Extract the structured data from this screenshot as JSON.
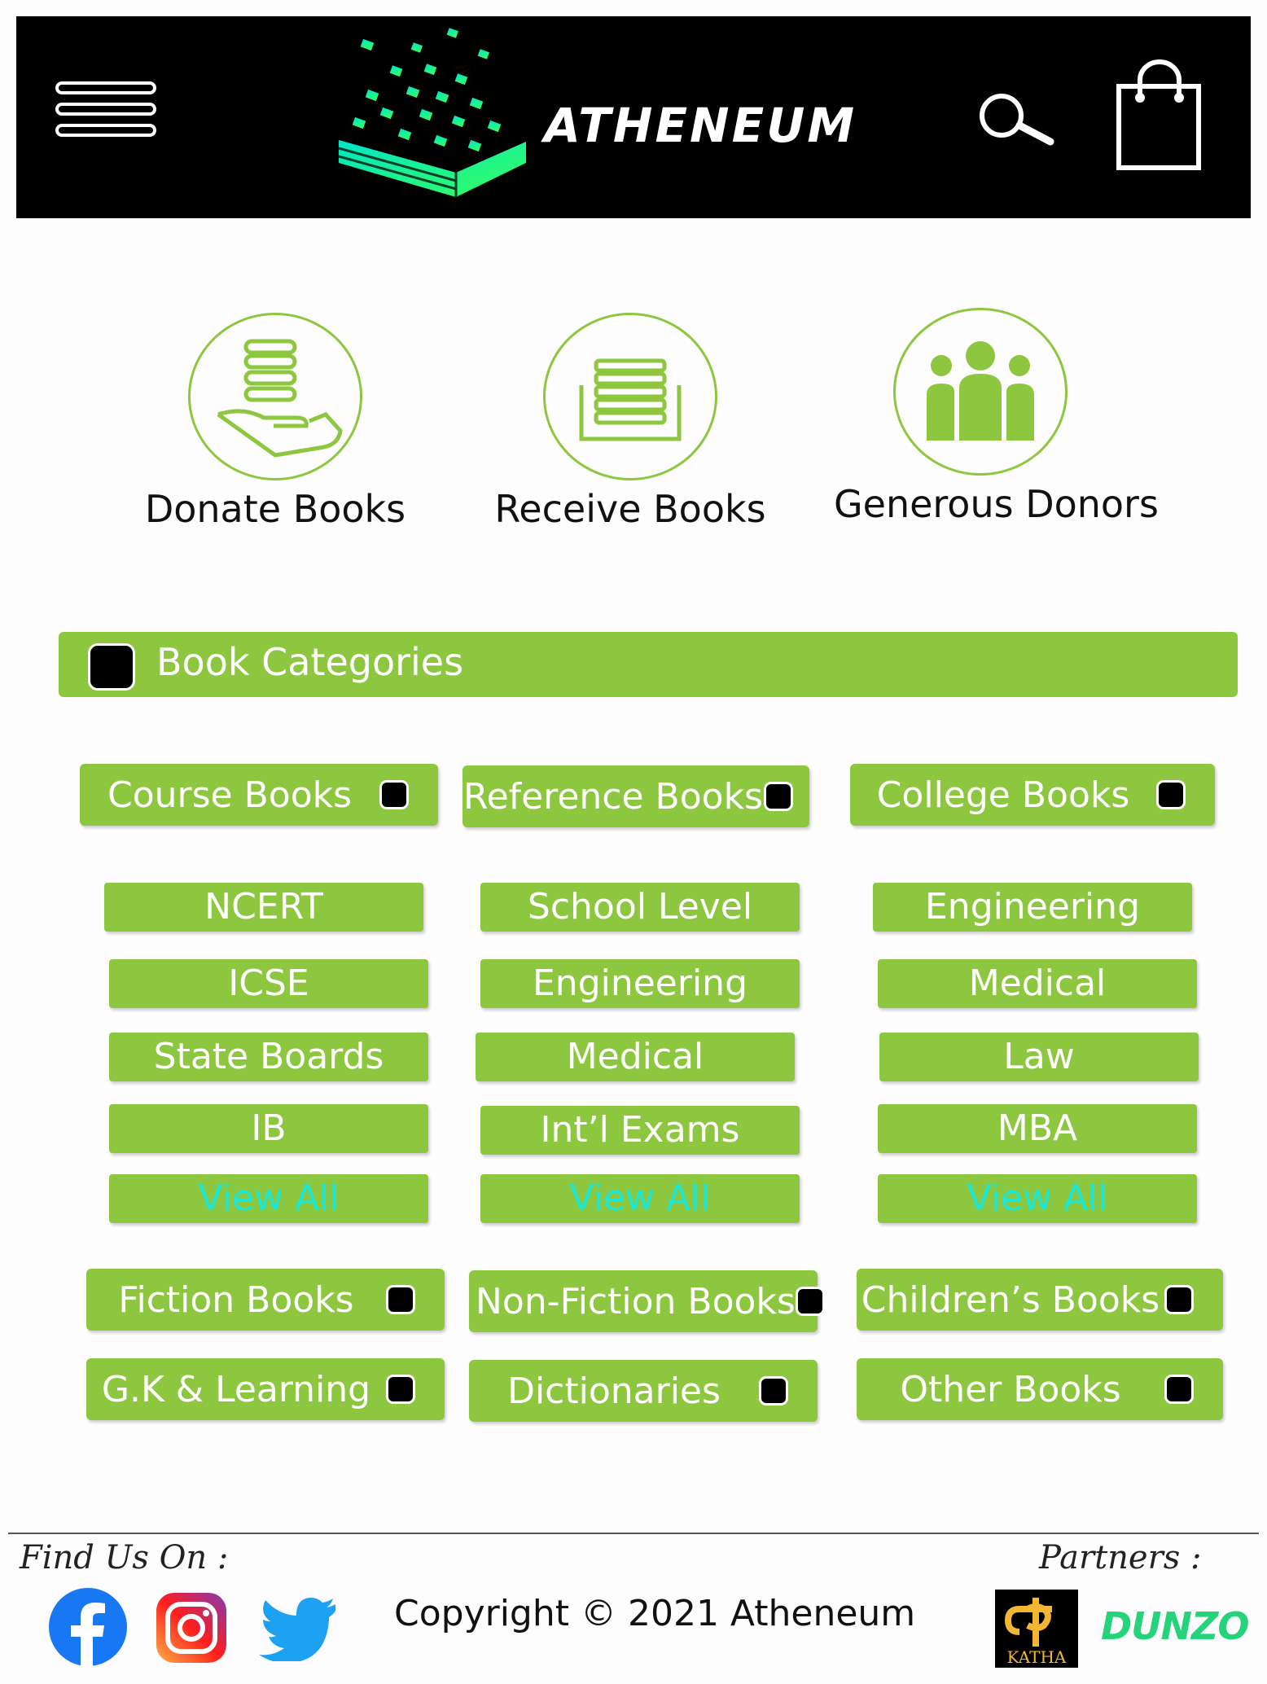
{
  "header": {
    "brand": "ATHENEUM",
    "icons": [
      "menu-icon",
      "book-logo-icon",
      "search-icon",
      "shopping-bag-icon"
    ]
  },
  "features": [
    {
      "label": "Donate Books",
      "icon": "donate-books-icon"
    },
    {
      "label": "Receive Books",
      "icon": "receive-books-icon"
    },
    {
      "label": "Generous Donors",
      "icon": "donors-icon"
    }
  ],
  "categories_bar": {
    "label": "Book Categories"
  },
  "groups": [
    {
      "label": "Course Books",
      "items": [
        "NCERT",
        "ICSE",
        "State Boards",
        "IB"
      ],
      "view_all": "View All"
    },
    {
      "label": "Reference Books",
      "items": [
        "School Level",
        "Engineering",
        "Medical",
        "Int’l Exams"
      ],
      "view_all": "View All"
    },
    {
      "label": "College Books",
      "items": [
        "Engineering",
        "Medical",
        "Law",
        "MBA"
      ],
      "view_all": "View All"
    }
  ],
  "more_categories": [
    "Fiction Books",
    "Non-Fiction Books",
    "Children’s Books",
    "G.K & Learning",
    "Dictionaries",
    "Other Books"
  ],
  "footer": {
    "find_us": "Find Us On :",
    "copyright": "Copyright © 2021 Atheneum",
    "partners_label": "Partners :",
    "partners": [
      {
        "name": "KATHA"
      },
      {
        "name": "DUNZO"
      }
    ],
    "social": [
      "facebook-icon",
      "instagram-icon",
      "twitter-icon"
    ]
  },
  "colors": {
    "accent": "#8dc63f",
    "view_all": "#18e9d9",
    "header_bg": "#000000",
    "logo_gradient": [
      "#00e5c8",
      "#39ff5a"
    ]
  }
}
